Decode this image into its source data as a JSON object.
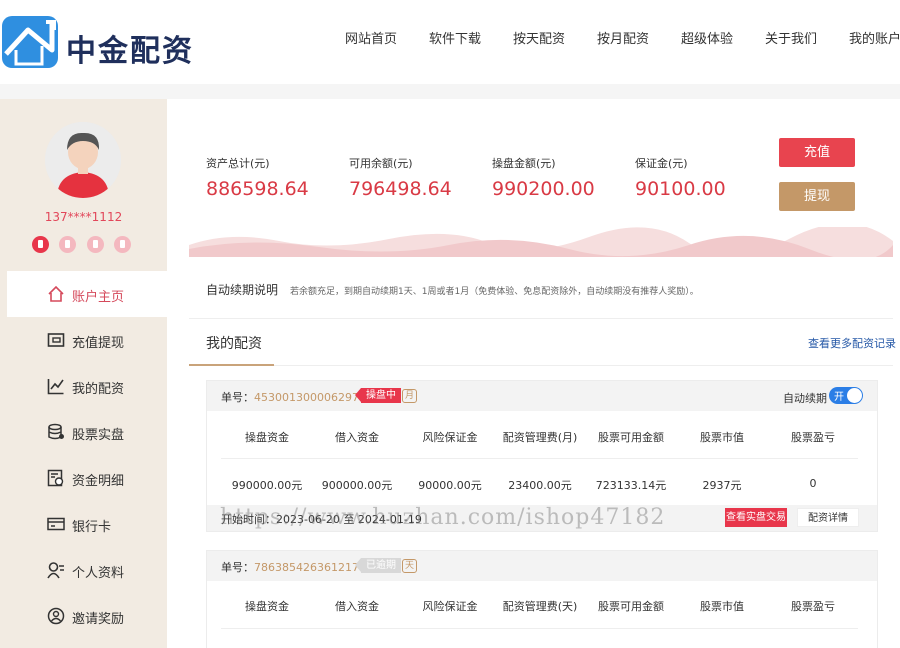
{
  "brand": {
    "name": "中金配资",
    "color": "#1f2f5c",
    "accent": "#2f8fe0"
  },
  "nav": [
    "网站首页",
    "软件下载",
    "按天配资",
    "按月配资",
    "超级体验",
    "关于我们",
    "我的账户"
  ],
  "user": {
    "phone": "137****1112"
  },
  "sidebar": {
    "items": [
      {
        "label": "账户主页",
        "icon": "home-icon",
        "active": true
      },
      {
        "label": "充值提现",
        "icon": "wallet-icon"
      },
      {
        "label": "我的配资",
        "icon": "chart-icon"
      },
      {
        "label": "股票实盘",
        "icon": "database-icon"
      },
      {
        "label": "资金明细",
        "icon": "ledger-icon"
      },
      {
        "label": "银行卡",
        "icon": "bank-card-icon"
      },
      {
        "label": "个人资料",
        "icon": "user-profile-icon"
      },
      {
        "label": "邀请奖励",
        "icon": "invite-icon"
      }
    ]
  },
  "stats": [
    {
      "label": "资产总计(元)",
      "value": "886598.64"
    },
    {
      "label": "可用余额(元)",
      "value": "796498.64"
    },
    {
      "label": "操盘金额(元)",
      "value": "990200.00"
    },
    {
      "label": "保证金(元)",
      "value": "90100.00"
    }
  ],
  "buttons": {
    "recharge": "充值",
    "withdraw": "提现"
  },
  "renew": {
    "title": "自动续期说明",
    "desc": "若余额充足，到期自动续期1天、1周或者1月（免费体验、免息配资除外，自动续期没有推荐人奖励）。"
  },
  "my_financing": {
    "title": "我的配资",
    "more": "查看更多配资记录"
  },
  "orders": [
    {
      "no_label": "单号：",
      "no": "453001300006297",
      "status": "操盘中",
      "period": "月",
      "auto_renew_label": "自动续期",
      "toggle": "开",
      "columns": [
        "操盘资金",
        "借入资金",
        "风险保证金",
        "配资管理费(月)",
        "股票可用金额",
        "股票市值",
        "股票盈亏"
      ],
      "values": [
        "990000.00元",
        "900000.00元",
        "90000.00元",
        "23400.00元",
        "723133.14元",
        "2937元",
        "0"
      ],
      "time": "开始时间：2023-06-20 至 2024-01-19",
      "btn_live": "查看实盘交易",
      "btn_detail": "配资详情"
    },
    {
      "no_label": "单号：",
      "no": "786385426361217",
      "status": "已逾期",
      "period": "天",
      "columns": [
        "操盘资金",
        "借入资金",
        "风险保证金",
        "配资管理费(天)",
        "股票可用金额",
        "股票市值",
        "股票盈亏"
      ]
    }
  ],
  "watermark": "https://www.huzhan.com/ishop47182"
}
